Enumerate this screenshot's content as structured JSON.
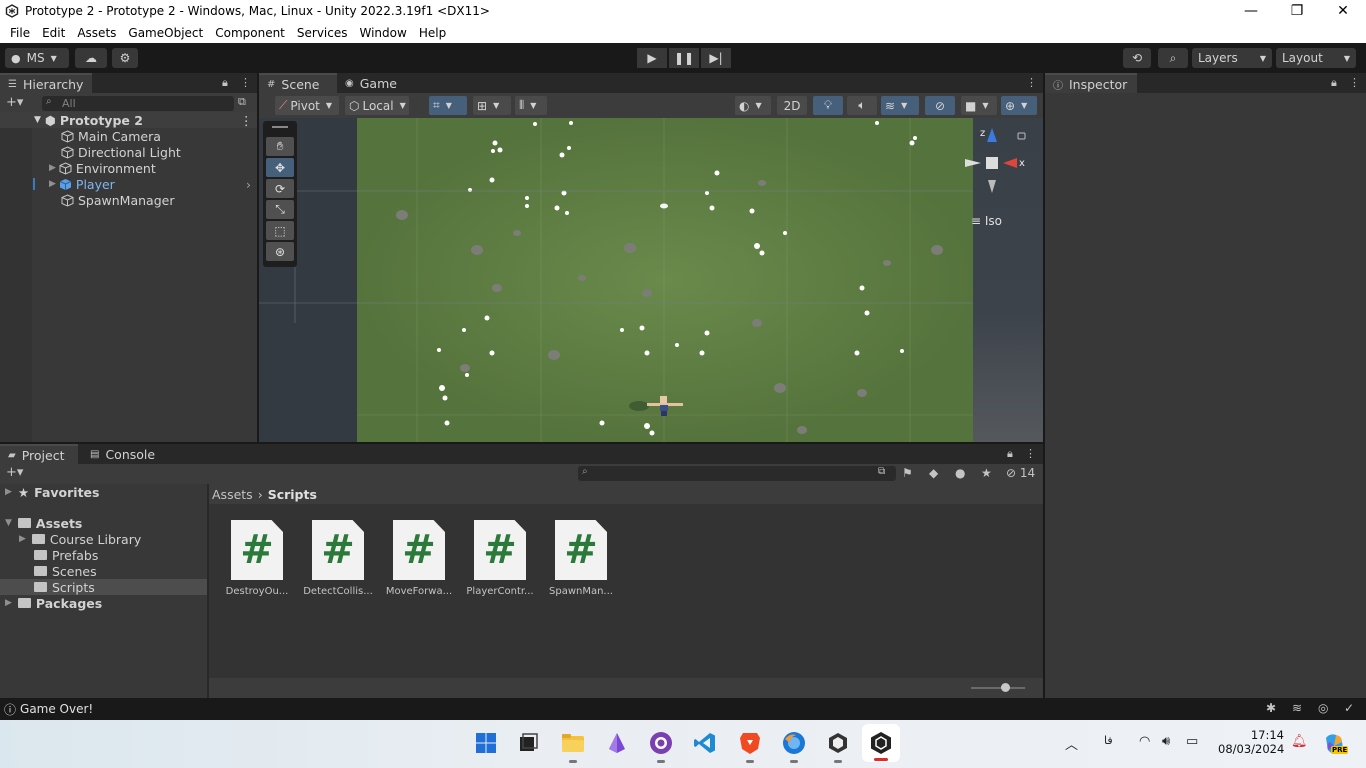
{
  "window": {
    "title": "Prototype 2 - Prototype 2 - Windows, Mac, Linux - Unity 2022.3.19f1 <DX11>",
    "minimize": "—",
    "restore": "❐",
    "close": "✕"
  },
  "menu": [
    "File",
    "Edit",
    "Assets",
    "GameObject",
    "Component",
    "Services",
    "Window",
    "Help"
  ],
  "toolbar": {
    "account": "MS",
    "layers": "Layers",
    "layout": "Layout"
  },
  "hierarchy": {
    "tab": "Hierarchy",
    "search_placeholder": "All",
    "scene_name": "Prototype 2",
    "items": [
      "Main Camera",
      "Directional Light",
      "Environment",
      "Player",
      "SpawnManager"
    ]
  },
  "scene": {
    "tabs": [
      "Scene",
      "Game"
    ],
    "pivot": "Pivot",
    "local": "Local",
    "mode_2d": "2D",
    "gizmo_z": "z",
    "gizmo_x": "x",
    "projection": "Iso"
  },
  "inspector": {
    "tab": "Inspector"
  },
  "project": {
    "tabs": [
      "Project",
      "Console"
    ],
    "hidden_count": "14",
    "breadcrumb_root": "Assets",
    "breadcrumb_current": "Scripts",
    "tree": {
      "favorites": "Favorites",
      "assets": "Assets",
      "children": [
        "Course Library",
        "Prefabs",
        "Scenes",
        "Scripts"
      ],
      "packages": "Packages"
    },
    "files": [
      "DestroyOu...",
      "DetectCollis...",
      "MoveForwa...",
      "PlayerContr...",
      "SpawnMan..."
    ],
    "script_glyph": "#"
  },
  "status": {
    "message": "Game Over!"
  },
  "taskbar": {
    "time": "17:14",
    "date": "08/03/2024",
    "lang": "فا",
    "copilot_badge": "PRE"
  },
  "colors": {
    "ground": "#5f7e44",
    "selected_item": "#7fb6f0",
    "script_hash": "#2b7a3a",
    "play_accent": "#46607c"
  }
}
